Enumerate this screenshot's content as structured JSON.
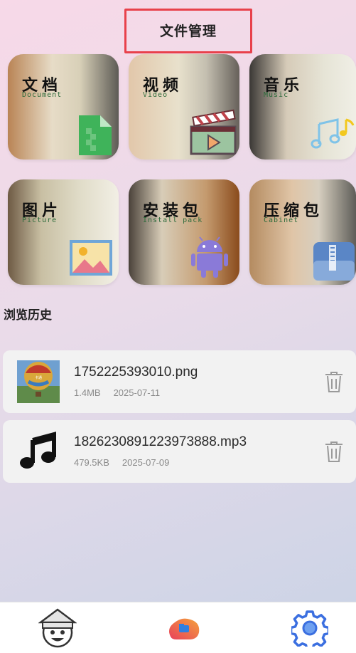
{
  "header": {
    "title": "文件管理"
  },
  "categories": [
    {
      "label": "文档",
      "sub": "Document",
      "icon": "document-icon"
    },
    {
      "label": "视频",
      "sub": "Video",
      "icon": "video-clapper-icon"
    },
    {
      "label": "音乐",
      "sub": "Music",
      "icon": "music-notes-icon"
    },
    {
      "label": "图片",
      "sub": "Picture",
      "icon": "picture-icon"
    },
    {
      "label": "安装包",
      "sub": "Install pack",
      "icon": "android-icon"
    },
    {
      "label": "压缩包",
      "sub": "Cabinet",
      "icon": "zip-file-icon"
    }
  ],
  "history": {
    "title": "浏览历史",
    "items": [
      {
        "name": "1752225393010.png",
        "size": "1.4MB",
        "date": "2025-07-11",
        "icon": "balloon-thumbnail"
      },
      {
        "name": "1826230891223973888.mp3",
        "size": "479.5KB",
        "date": "2025-07-09",
        "icon": "music-note-icon"
      }
    ]
  },
  "bottom_nav": [
    {
      "name": "avatar-tab",
      "icon": "avatar-icon"
    },
    {
      "name": "files-tab",
      "icon": "folder-logo-icon"
    },
    {
      "name": "settings-tab",
      "icon": "gear-icon"
    }
  ],
  "colors": {
    "accent_red": "#e8414b",
    "settings_blue": "#3b6fe0"
  }
}
